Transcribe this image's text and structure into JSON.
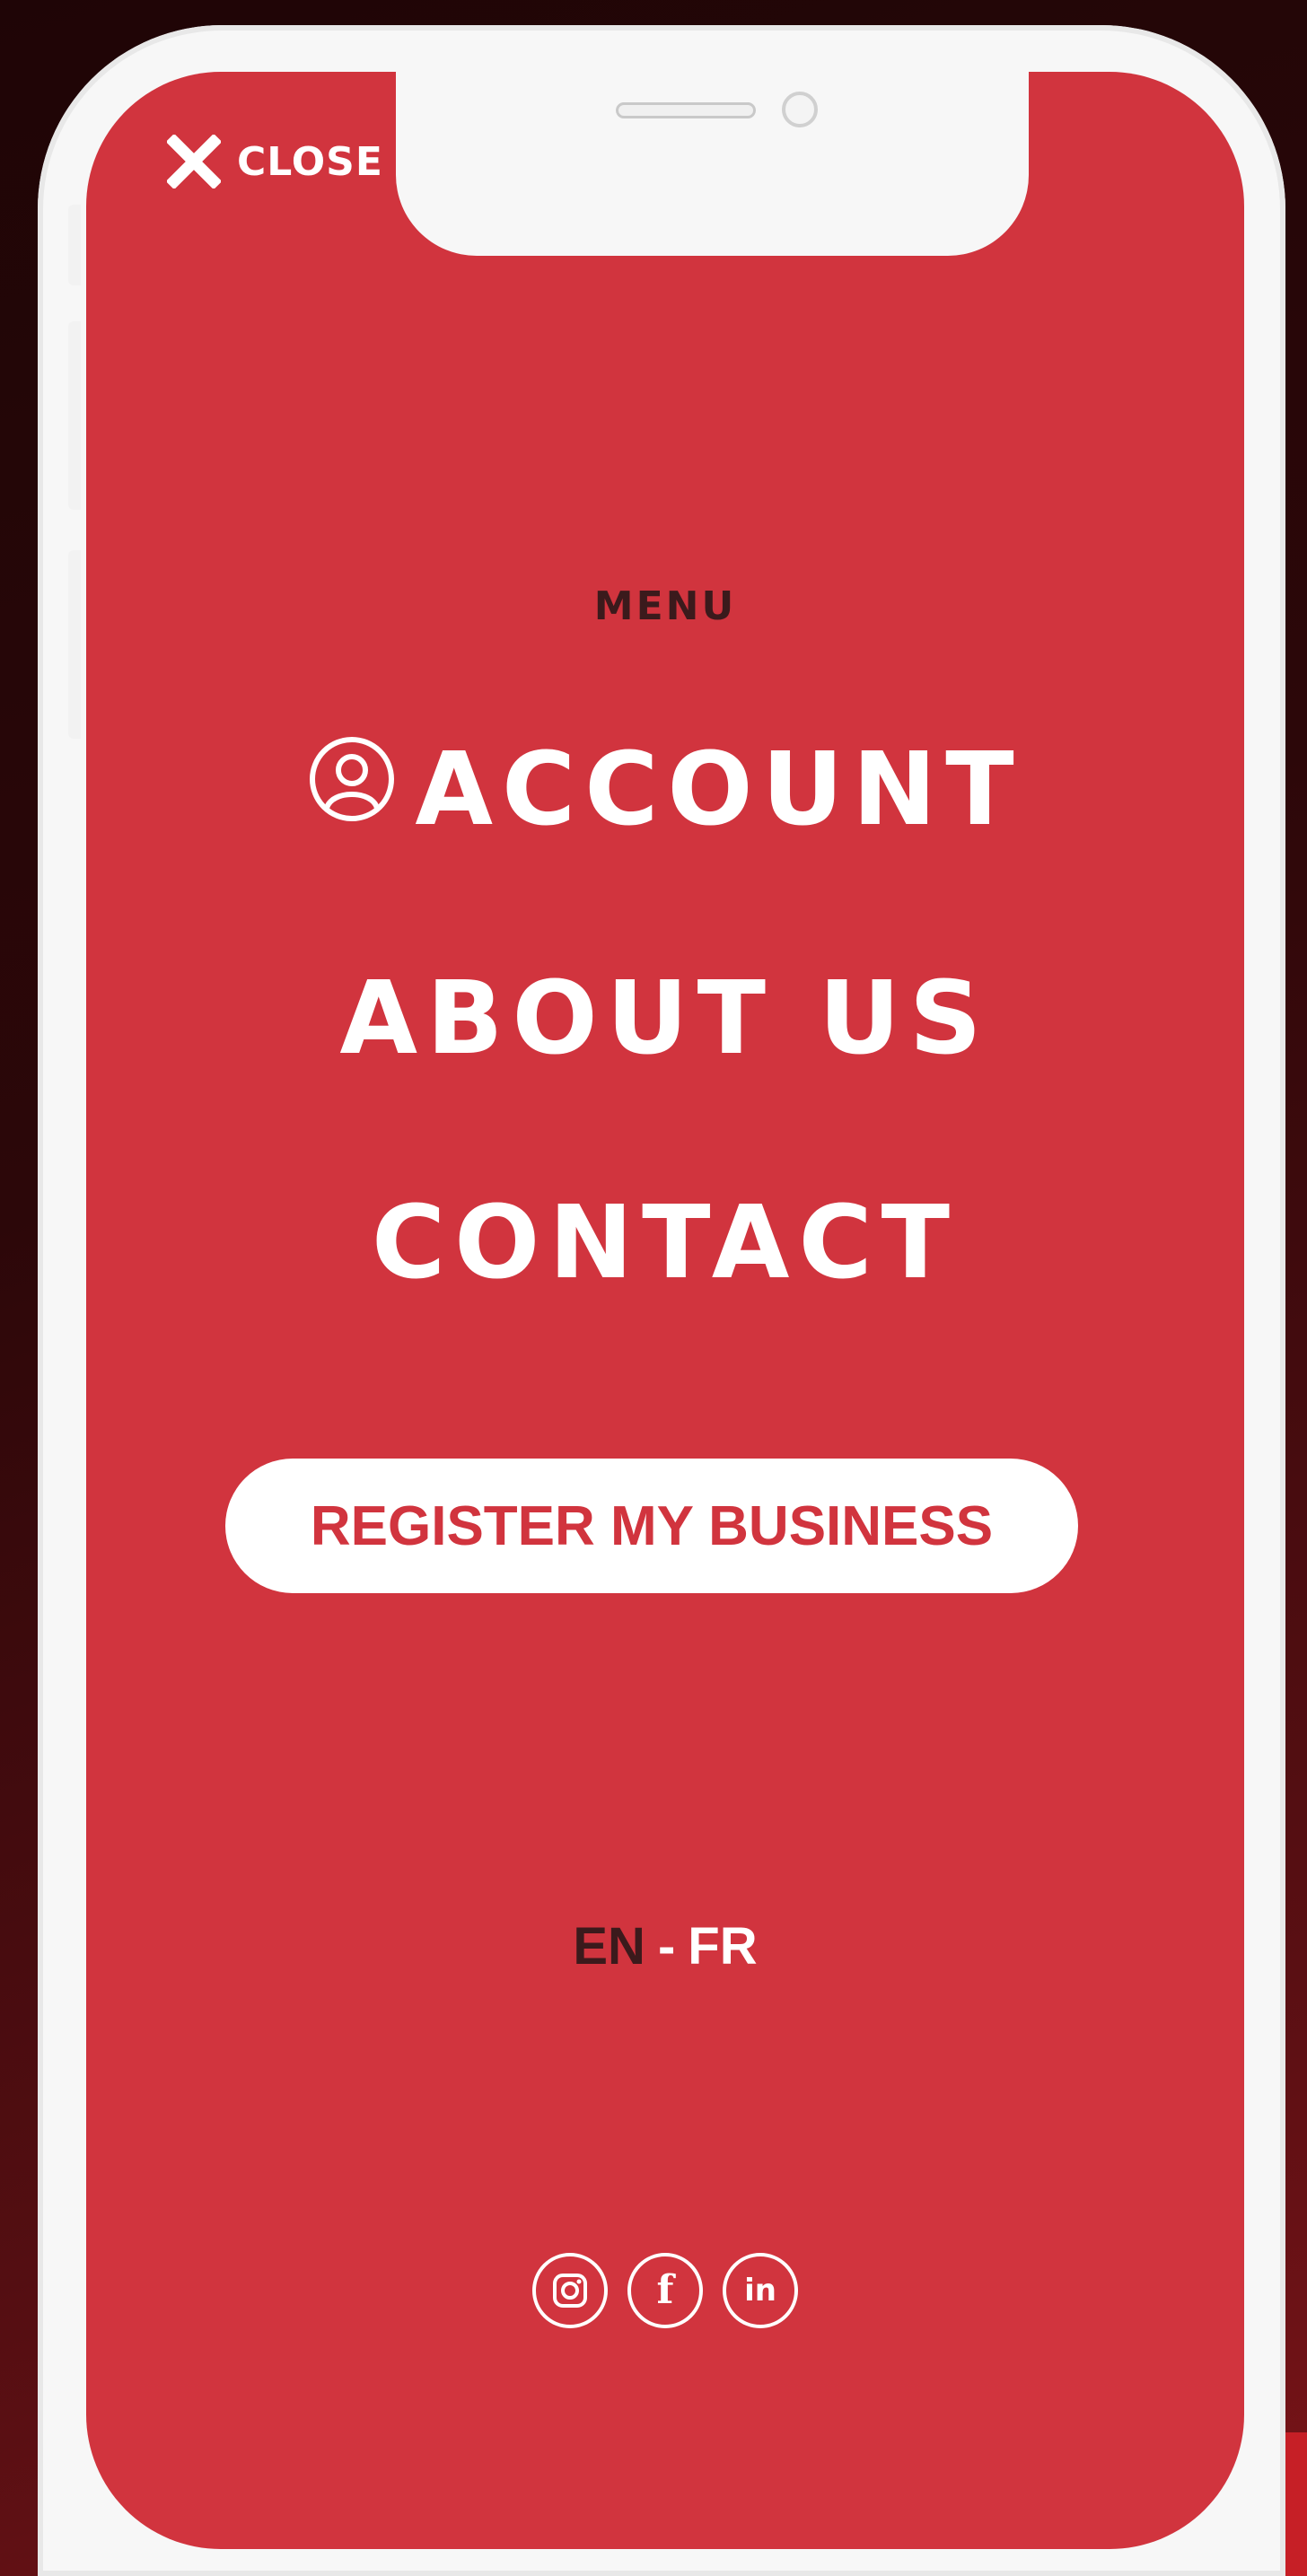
{
  "colors": {
    "screen_background": "#d1343e",
    "primary_text": "#ffffff",
    "dark_text": "#3b1a1c",
    "button_background": "#ffffff",
    "button_text": "#d1343e"
  },
  "header": {
    "close_label": "CLOSE",
    "close_icon": "close-x-icon"
  },
  "menu": {
    "heading": "MENU",
    "items": [
      {
        "label": "ACCOUNT",
        "icon": "user-circle-icon"
      },
      {
        "label": "ABOUT US"
      },
      {
        "label": "CONTACT"
      }
    ]
  },
  "cta": {
    "label": "REGISTER MY BUSINESS"
  },
  "language": {
    "options": [
      "EN",
      "FR"
    ],
    "separator": "-",
    "selected": "EN"
  },
  "social": {
    "icons": [
      "instagram-icon",
      "facebook-icon",
      "linkedin-icon"
    ],
    "facebook_glyph": "f",
    "linkedin_glyph": "in"
  }
}
